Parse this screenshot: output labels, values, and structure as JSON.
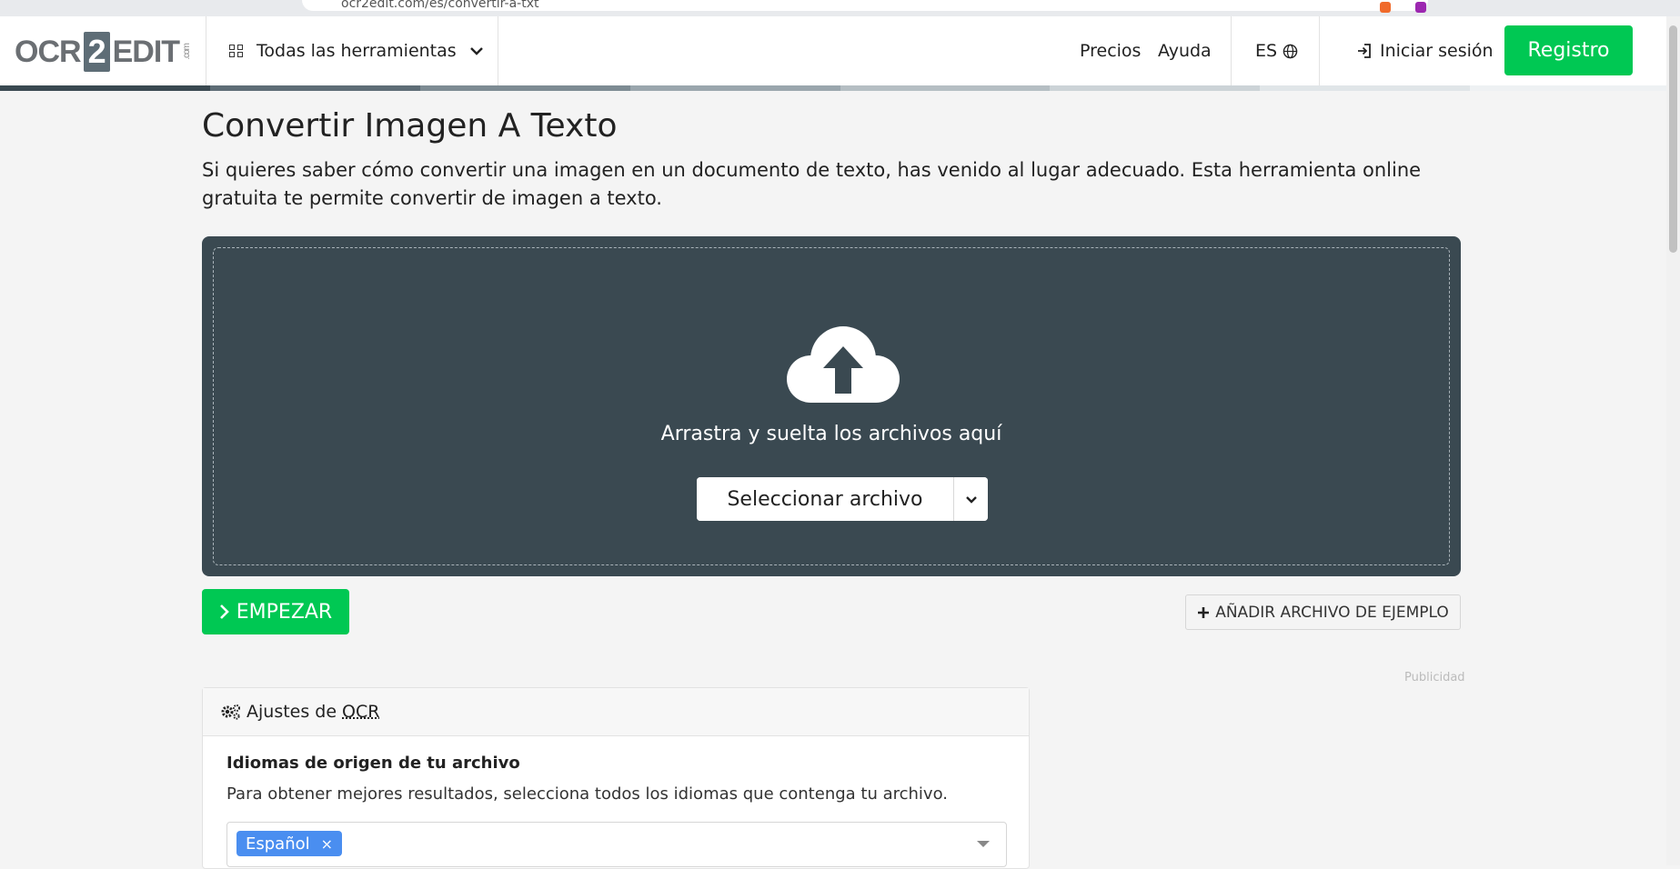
{
  "browser": {
    "url": "ocr2edit.com/es/convertir-a-txt"
  },
  "header": {
    "logo": {
      "prefix": "OCR",
      "number": "2",
      "suffix": "EDIT",
      "domain": ".com"
    },
    "tools_label": "Todas las herramientas",
    "nav": {
      "pricing": "Precios",
      "help": "Ayuda",
      "language": "ES"
    },
    "login_label": "Iniciar sesión",
    "register_label": "Registro",
    "progress_colors": [
      "#3a4951",
      "#5e6d76",
      "#7d8b93",
      "#9aa6ad",
      "#b5bec3",
      "#ccd3d7",
      "#e0e5e8",
      "#eef1f3"
    ]
  },
  "main": {
    "title": "Convertir Imagen A Texto",
    "description": "Si quieres saber cómo convertir una imagen en un documento de texto, has venido al lugar adecuado. Esta herramienta online gratuita te permite convertir de imagen a texto.",
    "dropzone": {
      "drop_text": "Arrastra y suelta los archivos aquí",
      "select_label": "Seleccionar archivo"
    },
    "start_label": "EMPEZAR",
    "sample_label": "AÑADIR ARCHIVO DE EJEMPLO",
    "ad_label": "Publicidad"
  },
  "settings": {
    "title_prefix": "Ajustes de",
    "title_abbr": "OCR",
    "lang_title": "Idiomas de origen de tu archivo",
    "lang_help": "Para obtener mejores resultados, selecciona todos los idiomas que contenga tu archivo.",
    "selected_language": "Español",
    "remove_symbol": "×"
  },
  "colors": {
    "accent": "#00c853",
    "dropzone": "#3a4951",
    "tag": "#4a8ef0"
  }
}
